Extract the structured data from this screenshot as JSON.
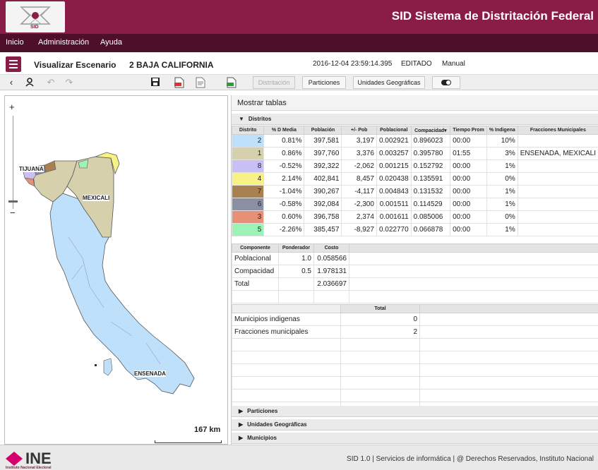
{
  "header": {
    "app_title": "SID Sistema de Distritación Federal",
    "logo_text": "SID"
  },
  "menu": {
    "items": [
      "Inicio",
      "Administración",
      "Ayuda"
    ]
  },
  "scenario": {
    "title": "Visualizar Escenario",
    "entity": "2 BAJA CALIFORNIA",
    "timestamp": "2016-12-04 23:59:14.395",
    "status": "EDITADO",
    "mode": "Manual"
  },
  "toolbar": {
    "distritacion": "Distritación",
    "particiones": "Particiones",
    "unidades": "Unidades Geográficas"
  },
  "map": {
    "zoom_in": "+",
    "zoom_out": "−",
    "labels": {
      "tijuana": "TIJUANA",
      "mexicali": "MEXICALI",
      "ensenada": "ENSENADA"
    },
    "scale_label": "167 km"
  },
  "panel": {
    "mostrar_tablas": "Mostrar tablas",
    "distritos_label": "Distritos",
    "particiones_label": "Particiones",
    "unidades_label": "Unidades Geográficas",
    "municipios_label": "Municipios"
  },
  "distritos": {
    "headers": [
      "Distrito",
      "% D Media",
      "Población",
      "+/- Pob",
      "Poblacional",
      "Compacidad▾",
      "Tiempo Prom",
      "% Indigena",
      "Fracciones Municipales"
    ],
    "rows": [
      {
        "id": "2",
        "color": "#bfe0fb",
        "d_media": "0.81%",
        "poblacion": "397,581",
        "pob": "3,197",
        "poblacional": "0.002921",
        "compacidad": "0.896023",
        "tiempo": "00:00",
        "indigena": "10%",
        "fracciones": ""
      },
      {
        "id": "1",
        "color": "#d6d0ad",
        "d_media": "0.86%",
        "poblacion": "397,760",
        "pob": "3,376",
        "poblacional": "0.003257",
        "compacidad": "0.395780",
        "tiempo": "01:55",
        "indigena": "3%",
        "fracciones": "ENSENADA, MEXICALI"
      },
      {
        "id": "8",
        "color": "#c8c0f4",
        "d_media": "-0.52%",
        "poblacion": "392,322",
        "pob": "-2,062",
        "poblacional": "0.001215",
        "compacidad": "0.152792",
        "tiempo": "00:00",
        "indigena": "1%",
        "fracciones": ""
      },
      {
        "id": "4",
        "color": "#f8f284",
        "d_media": "2.14%",
        "poblacion": "402,841",
        "pob": "8,457",
        "poblacional": "0.020438",
        "compacidad": "0.135591",
        "tiempo": "00:00",
        "indigena": "0%",
        "fracciones": ""
      },
      {
        "id": "7",
        "color": "#a9804f",
        "d_media": "-1.04%",
        "poblacion": "390,267",
        "pob": "-4,117",
        "poblacional": "0.004843",
        "compacidad": "0.131532",
        "tiempo": "00:00",
        "indigena": "1%",
        "fracciones": ""
      },
      {
        "id": "6",
        "color": "#8c8fa3",
        "d_media": "-0.58%",
        "poblacion": "392,084",
        "pob": "-2,300",
        "poblacional": "0.001511",
        "compacidad": "0.114529",
        "tiempo": "00:00",
        "indigena": "1%",
        "fracciones": ""
      },
      {
        "id": "3",
        "color": "#e88f78",
        "d_media": "0.60%",
        "poblacion": "396,758",
        "pob": "2,374",
        "poblacional": "0.001611",
        "compacidad": "0.085006",
        "tiempo": "00:00",
        "indigena": "0%",
        "fracciones": ""
      },
      {
        "id": "5",
        "color": "#9df3b5",
        "d_media": "-2.26%",
        "poblacion": "385,457",
        "pob": "-8,927",
        "poblacional": "0.022770",
        "compacidad": "0.066878",
        "tiempo": "00:00",
        "indigena": "1%",
        "fracciones": ""
      }
    ]
  },
  "componentes": {
    "headers": [
      "Componente",
      "Ponderador",
      "Costo"
    ],
    "rows": [
      {
        "componente": "Poblacional",
        "ponderador": "1.0",
        "costo": "0.058566"
      },
      {
        "componente": "Compacidad",
        "ponderador": "0.5",
        "costo": "1.978131"
      },
      {
        "componente": "Total",
        "ponderador": "",
        "costo": "2.036697"
      }
    ]
  },
  "totales": {
    "header": "Total",
    "rows": [
      {
        "label": "Municipios indigenas",
        "value": "0"
      },
      {
        "label": "Fracciones municipales",
        "value": "2"
      }
    ]
  },
  "footer": {
    "brand": "INE",
    "brand_sub": "Instituto Nacional Electoral",
    "text": "SID 1.0 | Servicios de informática | @ Derechos Reservados, Instituto Nacional"
  },
  "colors": {
    "brand": "#8a1d47",
    "brand_dark": "#4e0f2b",
    "district_blue": "#bfe0fb",
    "district_tan": "#d6d0ad"
  }
}
